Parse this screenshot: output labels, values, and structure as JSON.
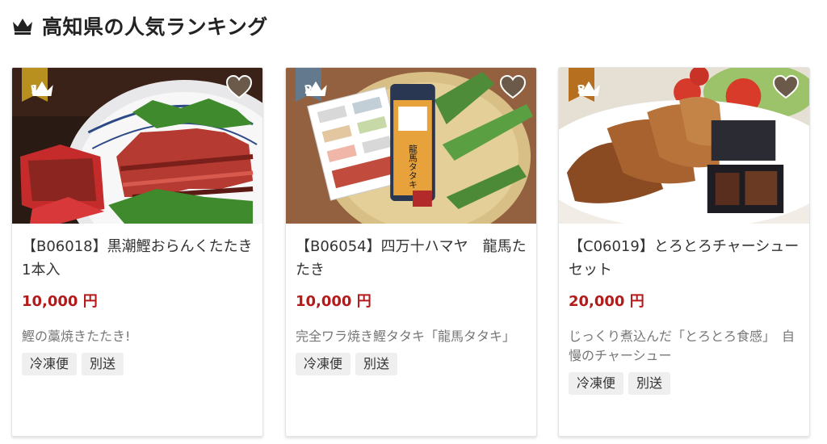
{
  "header": {
    "title": "高知県の人気ランキング",
    "icon": "crown-icon"
  },
  "colors": {
    "price": "#b31b1b",
    "rank1": "#b8901f",
    "rank2": "#63798d",
    "rank3": "#b56f1e",
    "favorite": "#6b5a4a"
  },
  "products": [
    {
      "rank": "1",
      "name": "【B06018】黒潮鰹おらんくたたき1本入",
      "price": "10,000 円",
      "description": "鰹の藁焼きたたき!",
      "tags": [
        "冷凍便",
        "別送"
      ],
      "image": "seared-bonito-plate"
    },
    {
      "rank": "2",
      "name": "【B06054】四万十ハマヤ　龍馬たたき",
      "price": "10,000 円",
      "description": "完全ワラ焼き鰹タタキ「龍馬タタキ」",
      "tags": [
        "冷凍便",
        "別送"
      ],
      "image": "ryoma-tataki-package",
      "image_label": "龍馬タタキ"
    },
    {
      "rank": "3",
      "name": "【C06019】とろとろチャーシューセット",
      "price": "20,000 円",
      "description": "じっくり煮込んだ「とろとろ食感」　自慢のチャーシュー",
      "tags": [
        "冷凍便",
        "別送"
      ],
      "image": "chashu-pork-set"
    }
  ]
}
